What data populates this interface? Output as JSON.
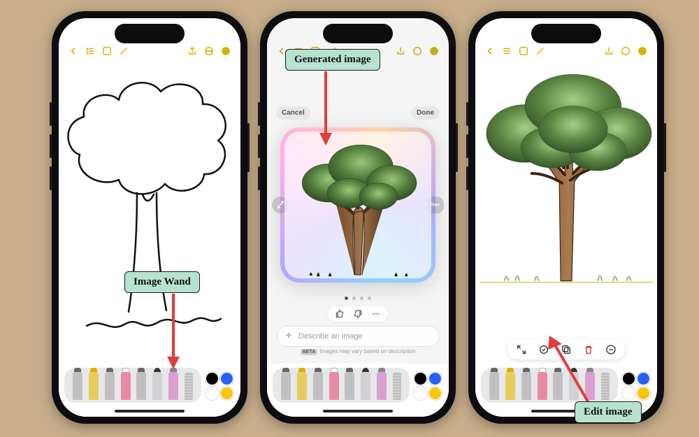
{
  "callouts": {
    "image_wand": "Image Wand",
    "generated_image": "Generated image",
    "edit_image": "Edit image"
  },
  "phone2": {
    "cancel": "Cancel",
    "done": "Done",
    "nav_prev_alt": "Tree",
    "nav_next_text": "Tree",
    "prompt_placeholder": "Describe an image",
    "beta_badge": "BETA",
    "beta_note": "Images may vary based on description"
  },
  "toolbar": {
    "tools": [
      {
        "name": "pen-tool",
        "interact": true
      },
      {
        "name": "marker-tool",
        "interact": true
      },
      {
        "name": "highlighter-tool",
        "interact": true
      },
      {
        "name": "eraser-tool",
        "interact": true
      },
      {
        "name": "lasso-tool",
        "interact": true
      },
      {
        "name": "pencil-tool",
        "interact": true
      },
      {
        "name": "image-wand-tool",
        "interact": true
      },
      {
        "name": "ruler-tool",
        "interact": true
      }
    ]
  }
}
